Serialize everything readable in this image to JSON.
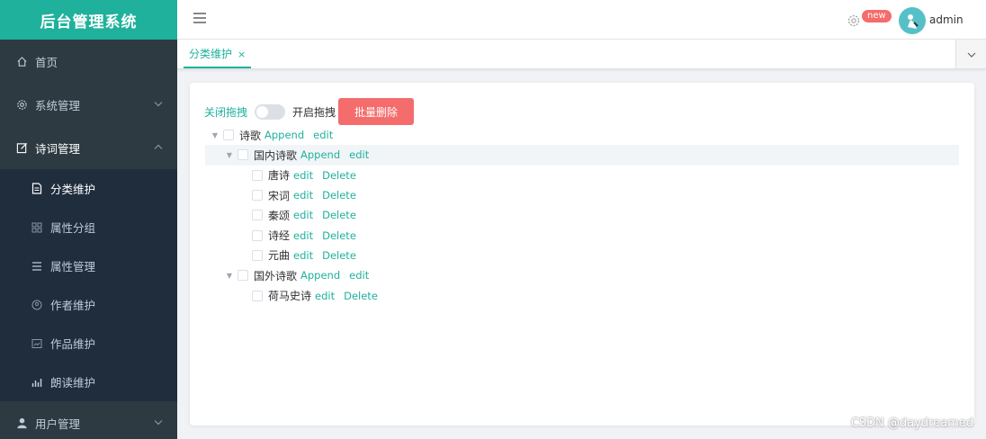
{
  "app": {
    "title": "后台管理系统"
  },
  "sidebar": {
    "items": [
      {
        "label": "首页",
        "icon": "home-icon"
      },
      {
        "label": "系统管理",
        "icon": "gear-icon"
      },
      {
        "label": "诗词管理",
        "icon": "edit-icon",
        "open": true
      },
      {
        "label": "用户管理",
        "icon": "user-icon"
      }
    ],
    "submenu": [
      {
        "label": "分类维护",
        "icon": "document-icon",
        "active": true
      },
      {
        "label": "属性分组",
        "icon": "grid-icon"
      },
      {
        "label": "属性管理",
        "icon": "list-icon"
      },
      {
        "label": "作者维护",
        "icon": "person-circle-icon"
      },
      {
        "label": "作品维护",
        "icon": "picture-icon"
      },
      {
        "label": "朗读维护",
        "icon": "bar-chart-icon"
      }
    ]
  },
  "header": {
    "badge": "new",
    "username": "admin"
  },
  "tabs": [
    {
      "label": "分类维护",
      "close": "×"
    }
  ],
  "toolbar": {
    "switch_off_label": "关闭拖拽",
    "switch_on_label": "开启拖拽",
    "batch_delete_label": "批量删除"
  },
  "tree": {
    "append_label": "Append",
    "edit_label": "edit",
    "delete_label": "Delete",
    "nodes": [
      {
        "label": "诗歌",
        "level": 0,
        "expanded": true,
        "actions": [
          "Append",
          "edit"
        ]
      },
      {
        "label": "国内诗歌",
        "level": 1,
        "expanded": true,
        "actions": [
          "Append",
          "edit"
        ],
        "highlighted": true
      },
      {
        "label": "唐诗",
        "level": 2,
        "actions": [
          "edit",
          "Delete"
        ]
      },
      {
        "label": "宋词",
        "level": 2,
        "actions": [
          "edit",
          "Delete"
        ]
      },
      {
        "label": "秦颂",
        "level": 2,
        "actions": [
          "edit",
          "Delete"
        ]
      },
      {
        "label": "诗经",
        "level": 2,
        "actions": [
          "edit",
          "Delete"
        ]
      },
      {
        "label": "元曲",
        "level": 2,
        "actions": [
          "edit",
          "Delete"
        ]
      },
      {
        "label": "国外诗歌",
        "level": 1,
        "expanded": true,
        "actions": [
          "Append",
          "edit"
        ]
      },
      {
        "label": "荷马史诗",
        "level": 2,
        "actions": [
          "edit",
          "Delete"
        ]
      }
    ]
  },
  "watermark": "CSDN @daydreamed",
  "colors": {
    "accent": "#1fb19c",
    "sidebar": "#2d3a42",
    "danger": "#f56c6c"
  }
}
